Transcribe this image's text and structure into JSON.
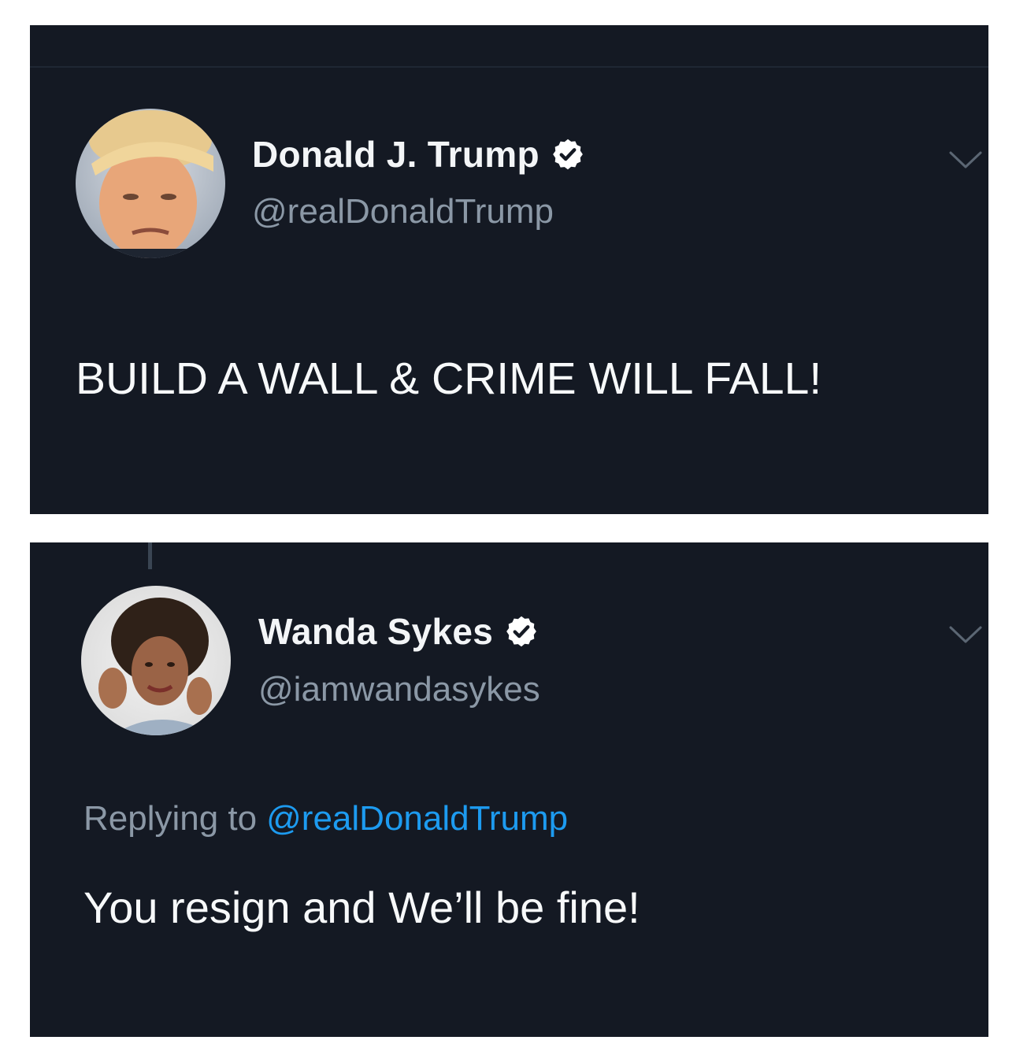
{
  "tweets": [
    {
      "author": {
        "name": "Donald J. Trump",
        "handle": "@realDonaldTrump",
        "verified": true
      },
      "text": "BUILD A WALL & CRIME WILL FALL!"
    },
    {
      "author": {
        "name": "Wanda Sykes",
        "handle": "@iamwandasykes",
        "verified": true
      },
      "reply": {
        "prefix": "Replying to",
        "handle": "@realDonaldTrump"
      },
      "text": "You resign and We’ll be fine!"
    }
  ],
  "icons": {
    "verified": "verified-badge-icon",
    "menu": "chevron-down-icon"
  },
  "colors": {
    "background": "#141923",
    "name": "#f3f5f7",
    "handle": "#8b98a6",
    "link": "#1d9bf0",
    "verified_badge": "#ffffff"
  }
}
